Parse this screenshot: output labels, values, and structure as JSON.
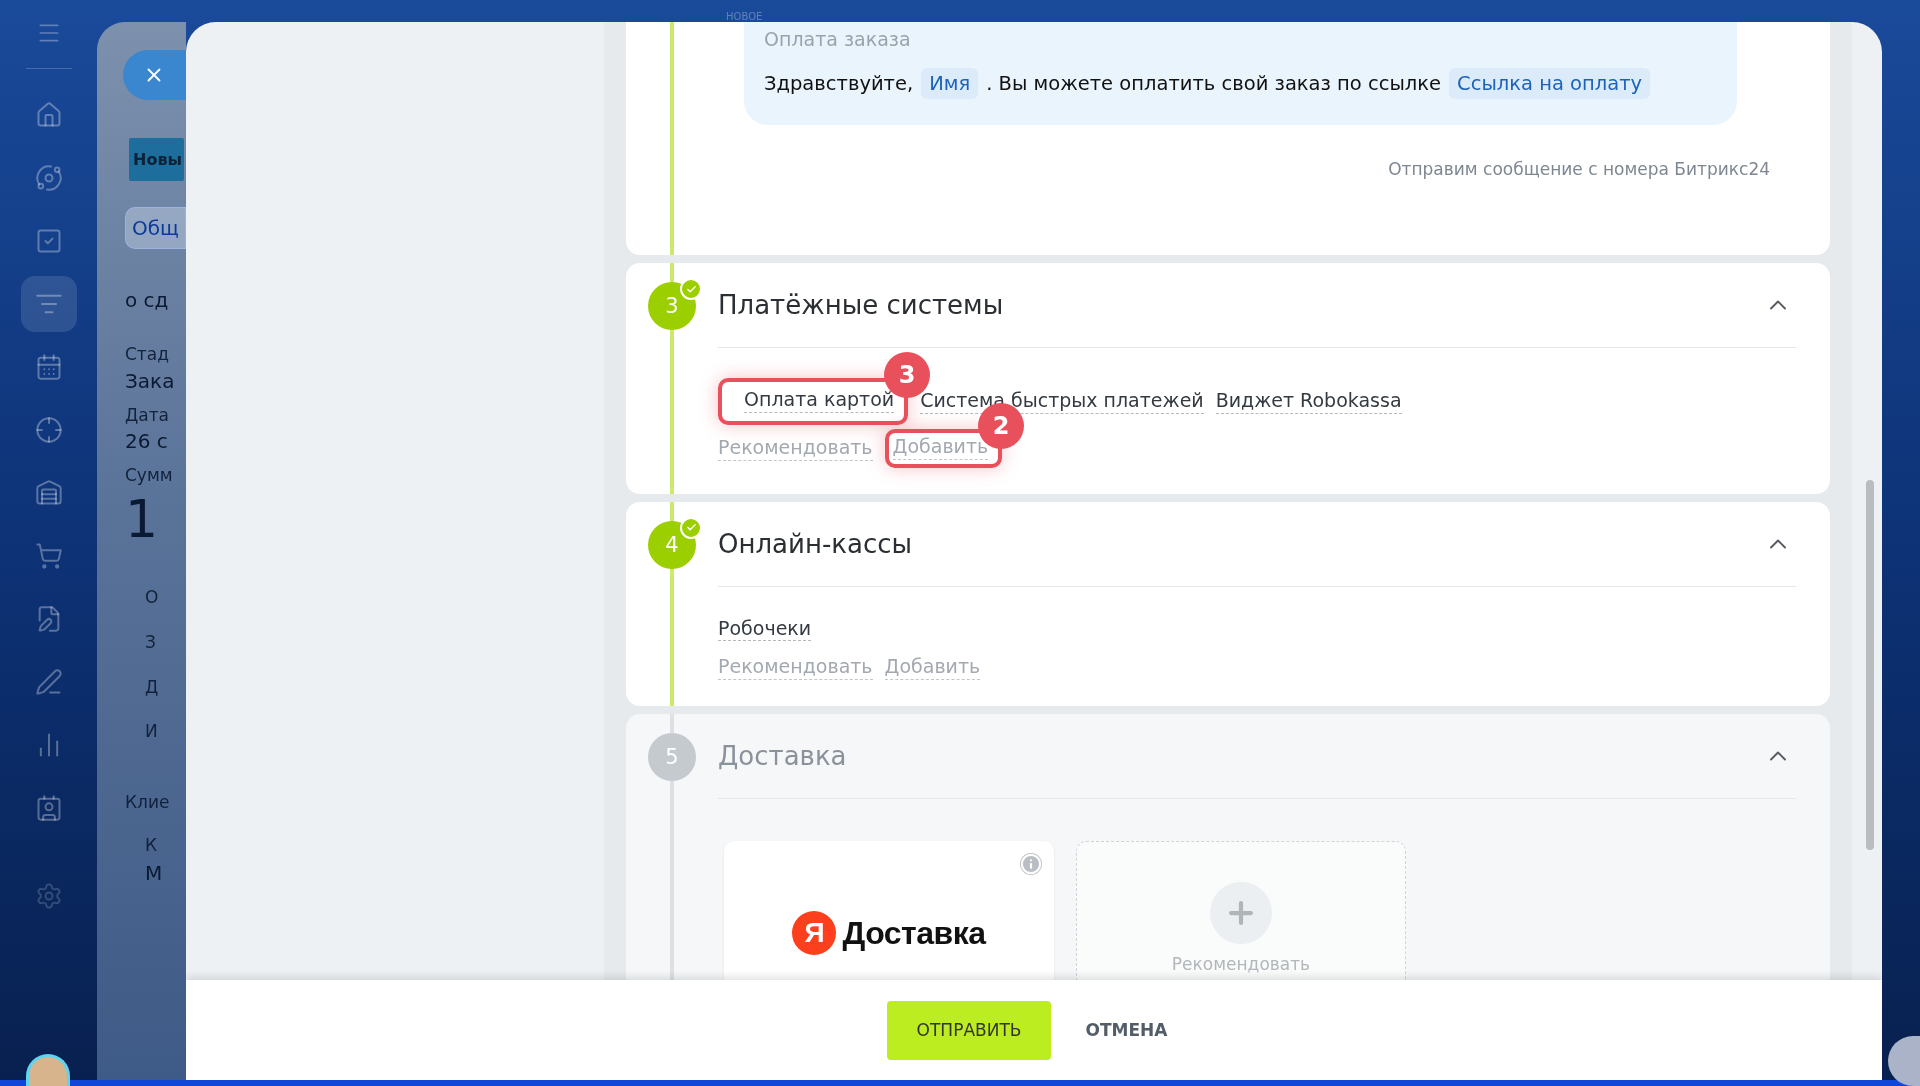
{
  "top_label": "НОВОЕ",
  "sidebar": {
    "items": [
      {
        "selected": false
      },
      {
        "selected": false
      },
      {
        "selected": false
      },
      {
        "selected": true
      },
      {
        "selected": false
      },
      {
        "selected": false
      },
      {
        "selected": false
      },
      {
        "selected": false
      },
      {
        "selected": false
      },
      {
        "selected": false
      },
      {
        "selected": false
      },
      {
        "selected": false
      }
    ]
  },
  "background_page": {
    "stage_button": "Новы",
    "filter_button": "Общ",
    "section_title": "о сд",
    "fields": [
      {
        "label": "Стад",
        "value": "Зака",
        "kind": "plain"
      },
      {
        "label": "Дата",
        "value": "26 с",
        "kind": "plain"
      },
      {
        "label": "Сумм",
        "value": "1",
        "kind": "big"
      }
    ],
    "inner_lines": [
      "О",
      "З",
      "Д",
      "И"
    ],
    "client_label": "Клие",
    "client_lines": [
      "К",
      "М"
    ]
  },
  "steps": [
    {
      "kind": "message",
      "done": true,
      "bubble_title": "Оплата заказа",
      "message": [
        {
          "kind": "text",
          "text": "Здравствуйте,"
        },
        {
          "kind": "tag",
          "text": "Имя"
        },
        {
          "kind": "text",
          "text": ". Вы можете оплатить свой заказ по ссылке"
        },
        {
          "kind": "tag",
          "text": "Ссылка на оплату"
        }
      ],
      "note": "Отправим сообщение с номера Битрикс24"
    },
    {
      "kind": "list",
      "number": "3",
      "done": true,
      "expanded": true,
      "title": "Платёжные системы",
      "items": [
        {
          "label": "Оплата картой",
          "callout": "3"
        },
        {
          "label": "Система быстрых платежей"
        },
        {
          "label": "Виджет Robokassa"
        }
      ],
      "links": [
        {
          "label": "Рекомендовать"
        },
        {
          "label": "Добавить",
          "callout": "2"
        }
      ]
    },
    {
      "kind": "list",
      "number": "4",
      "done": true,
      "expanded": true,
      "title": "Онлайн-кассы",
      "items": [
        {
          "label": "Робочеки"
        }
      ],
      "links": [
        {
          "label": "Рекомендовать"
        },
        {
          "label": "Добавить"
        }
      ]
    },
    {
      "kind": "tiles",
      "number": "5",
      "done": false,
      "expanded": true,
      "title": "Доставка",
      "tiles": [
        {
          "kind": "service",
          "logo_mark": "Я",
          "logo_text": "Доставка"
        },
        {
          "kind": "add",
          "label": "Рекомендовать"
        }
      ]
    }
  ],
  "footer": {
    "buttons": [
      {
        "label": "ОТПРАВИТЬ",
        "kind": "primary"
      },
      {
        "label": "ОТМЕНА",
        "kind": "plain"
      }
    ]
  }
}
